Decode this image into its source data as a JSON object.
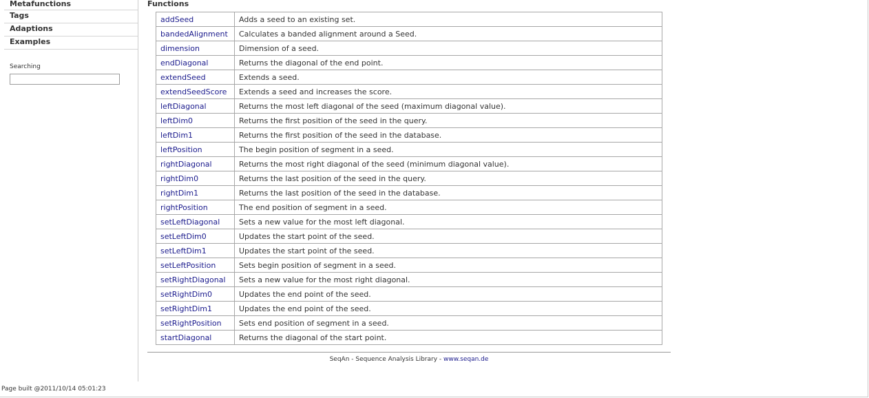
{
  "sidebar": {
    "nav": [
      {
        "label": "Metafunctions"
      },
      {
        "label": "Tags"
      },
      {
        "label": "Adaptions"
      },
      {
        "label": "Examples"
      }
    ],
    "search_label": "Searching",
    "search_value": ""
  },
  "main": {
    "section_title": "Functions",
    "functions": [
      {
        "name": "addSeed",
        "desc": "Adds a seed to an existing set."
      },
      {
        "name": "bandedAlignment",
        "desc": "Calculates a banded alignment around a Seed."
      },
      {
        "name": "dimension",
        "desc": "Dimension of a seed."
      },
      {
        "name": "endDiagonal",
        "desc": "Returns the diagonal of the end point."
      },
      {
        "name": "extendSeed",
        "desc": "Extends a seed."
      },
      {
        "name": "extendSeedScore",
        "desc": "Extends a seed and increases the score."
      },
      {
        "name": "leftDiagonal",
        "desc": "Returns the most left diagonal of the seed (maximum diagonal value)."
      },
      {
        "name": "leftDim0",
        "desc": "Returns the first position of the seed in the query."
      },
      {
        "name": "leftDim1",
        "desc": "Returns the first position of the seed in the database."
      },
      {
        "name": "leftPosition",
        "desc": "The begin position of segment in a seed."
      },
      {
        "name": "rightDiagonal",
        "desc": "Returns the most right diagonal of the seed (minimum diagonal value)."
      },
      {
        "name": "rightDim0",
        "desc": "Returns the last position of the seed in the query."
      },
      {
        "name": "rightDim1",
        "desc": "Returns the last position of the seed in the database."
      },
      {
        "name": "rightPosition",
        "desc": "The end position of segment in a seed."
      },
      {
        "name": "setLeftDiagonal",
        "desc": "Sets a new value for the most left diagonal."
      },
      {
        "name": "setLeftDim0",
        "desc": "Updates the start point of the seed."
      },
      {
        "name": "setLeftDim1",
        "desc": "Updates the start point of the seed."
      },
      {
        "name": "setLeftPosition",
        "desc": "Sets begin position of segment in a seed."
      },
      {
        "name": "setRightDiagonal",
        "desc": "Sets a new value for the most right diagonal."
      },
      {
        "name": "setRightDim0",
        "desc": "Updates the end point of the seed."
      },
      {
        "name": "setRightDim1",
        "desc": "Updates the end point of the seed."
      },
      {
        "name": "setRightPosition",
        "desc": "Sets end position of segment in a seed."
      },
      {
        "name": "startDiagonal",
        "desc": "Returns the diagonal of the start point."
      }
    ]
  },
  "footer": {
    "library_text": "SeqAn - Sequence Analysis Library - ",
    "link_text": "www.seqan.de",
    "built_text": "Page built @2011/10/14 05:01:23"
  },
  "colors": {
    "link": "#1a1a8c",
    "border": "#a6a6a6",
    "text": "#333333"
  }
}
